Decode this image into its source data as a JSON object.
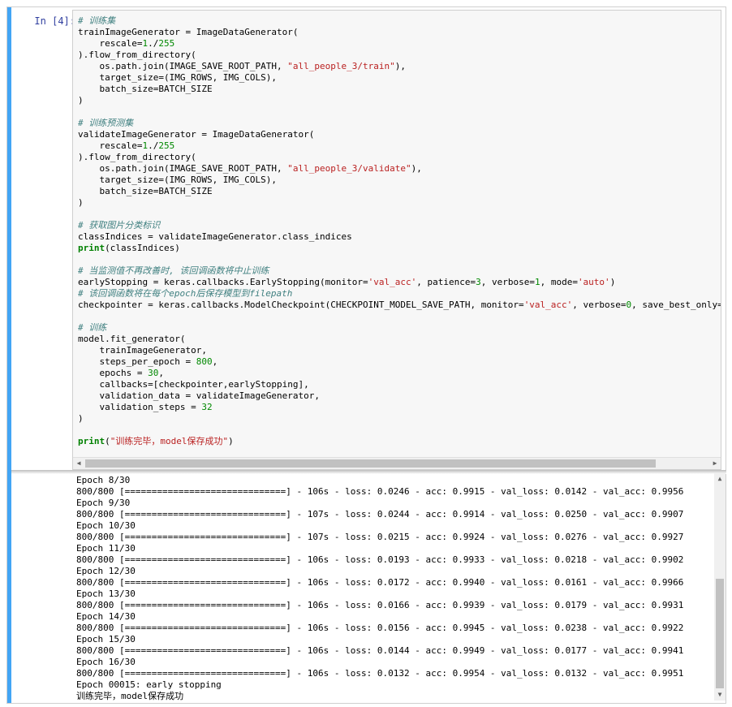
{
  "cell": {
    "prompt": "In  [4]:",
    "code": [
      "# 训练集",
      "trainImageGenerator = ImageDataGenerator(",
      "    rescale=1./255",
      ").flow_from_directory(",
      "    os.path.join(IMAGE_SAVE_ROOT_PATH, \"all_people_3/train\"),",
      "    target_size=(IMG_ROWS, IMG_COLS),",
      "    batch_size=BATCH_SIZE",
      ")",
      "",
      "# 训练预测集",
      "validateImageGenerator = ImageDataGenerator(",
      "    rescale=1./255",
      ").flow_from_directory(",
      "    os.path.join(IMAGE_SAVE_ROOT_PATH, \"all_people_3/validate\"),",
      "    target_size=(IMG_ROWS, IMG_COLS),",
      "    batch_size=BATCH_SIZE",
      ")",
      "",
      "# 获取图片分类标识",
      "classIndices = validateImageGenerator.class_indices",
      "print(classIndices)",
      "",
      "# 当监测值不再改善时, 该回调函数将中止训练",
      "earlyStopping = keras.callbacks.EarlyStopping(monitor='val_acc', patience=3, verbose=1, mode='auto')",
      "# 该回调函数将在每个epoch后保存模型到filepath",
      "checkpointer = keras.callbacks.ModelCheckpoint(CHECKPOINT_MODEL_SAVE_PATH, monitor='val_acc', verbose=0, save_best_only=False, mode='",
      "",
      "# 训练",
      "model.fit_generator(",
      "    trainImageGenerator,",
      "    steps_per_epoch = 800,",
      "    epochs = 30,",
      "    callbacks=[checkpointer,earlyStopping],",
      "    validation_data = validateImageGenerator,",
      "    validation_steps = 32",
      ")",
      "",
      "print(\"训练完毕，model保存成功\")"
    ],
    "output": [
      "Epoch 8/30",
      "800/800 [==============================] - 106s - loss: 0.0246 - acc: 0.9915 - val_loss: 0.0142 - val_acc: 0.9956",
      "Epoch 9/30",
      "800/800 [==============================] - 107s - loss: 0.0244 - acc: 0.9914 - val_loss: 0.0250 - val_acc: 0.9907",
      "Epoch 10/30",
      "800/800 [==============================] - 107s - loss: 0.0215 - acc: 0.9924 - val_loss: 0.0276 - val_acc: 0.9927",
      "Epoch 11/30",
      "800/800 [==============================] - 106s - loss: 0.0193 - acc: 0.9933 - val_loss: 0.0218 - val_acc: 0.9902",
      "Epoch 12/30",
      "800/800 [==============================] - 106s - loss: 0.0172 - acc: 0.9940 - val_loss: 0.0161 - val_acc: 0.9966",
      "Epoch 13/30",
      "800/800 [==============================] - 106s - loss: 0.0166 - acc: 0.9939 - val_loss: 0.0179 - val_acc: 0.9931",
      "Epoch 14/30",
      "800/800 [==============================] - 106s - loss: 0.0156 - acc: 0.9945 - val_loss: 0.0238 - val_acc: 0.9922",
      "Epoch 15/30",
      "800/800 [==============================] - 106s - loss: 0.0144 - acc: 0.9949 - val_loss: 0.0177 - val_acc: 0.9941",
      "Epoch 16/30",
      "800/800 [==============================] - 106s - loss: 0.0132 - acc: 0.9954 - val_loss: 0.0132 - val_acc: 0.9951",
      "Epoch 00015: early stopping",
      "训练完毕，model保存成功"
    ]
  },
  "scrollbars": {
    "left_arrow": "◀",
    "right_arrow": "▶",
    "up_arrow": "▲",
    "down_arrow": "▼"
  }
}
